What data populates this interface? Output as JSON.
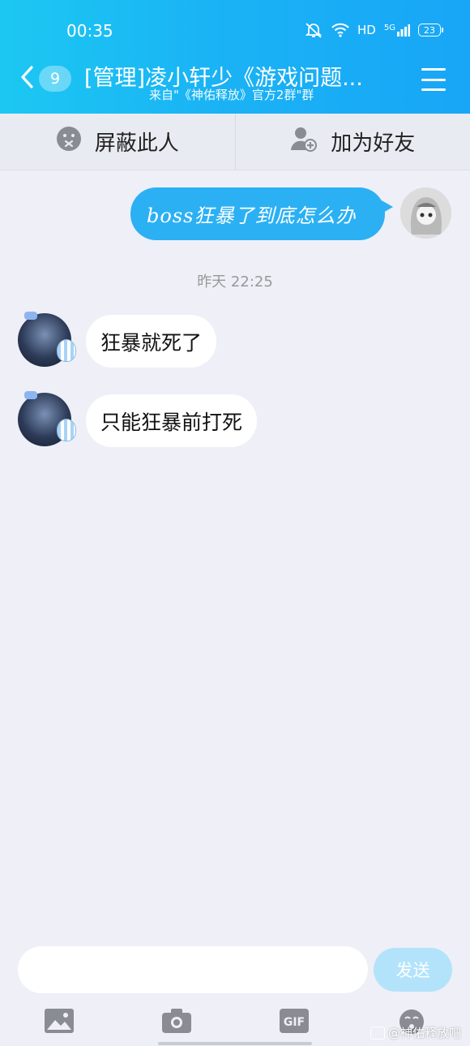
{
  "status_bar": {
    "time": "00:35",
    "network_label": "HD",
    "signal_label": "5G",
    "battery": "23"
  },
  "header": {
    "back_count": "9",
    "title": "[管理]凌小轩少《游戏问题...",
    "subtitle": "来自\"《神佑释放》官方2群\"群"
  },
  "actions": {
    "block_label": "屏蔽此人",
    "add_friend_label": "加为好友"
  },
  "messages": [
    {
      "from": "self",
      "text": "boss狂暴了到底怎么办"
    },
    {
      "from": "other",
      "text": "狂暴就死了"
    },
    {
      "from": "other",
      "text": "只能狂暴前打死"
    }
  ],
  "timestamp": "昨天 22:25",
  "composer": {
    "placeholder": "",
    "send_label": "发送"
  },
  "toolbar": {
    "gif_label": "GIF",
    "icons": [
      "image-icon",
      "camera-icon",
      "gif-icon",
      "emoji-icon"
    ]
  },
  "watermark": "@神佑释放吧",
  "colors": {
    "header_start": "#1cc8f2",
    "header_end": "#18a6f6",
    "sent_bubble": "#2cb0f4",
    "send_button": "#b3e3fb",
    "background": "#eeeff7"
  }
}
